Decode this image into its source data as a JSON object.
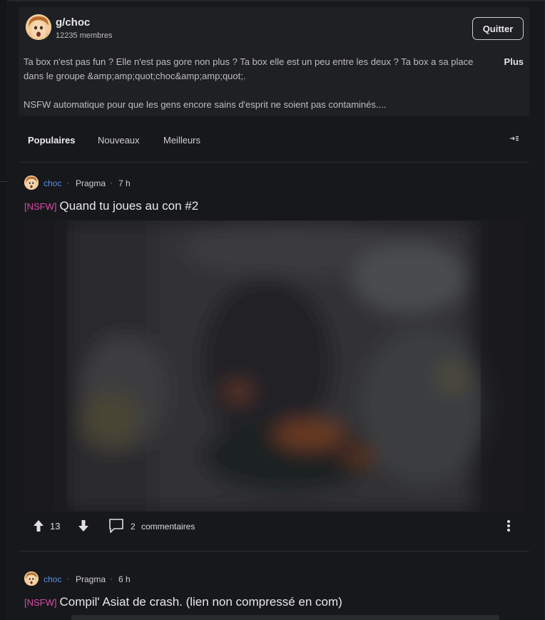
{
  "group": {
    "name": "g/choc",
    "members": "12235 membres",
    "quit_label": "Quitter",
    "description_line1": "Ta box n'est pas fun ? Elle n'est pas gore non plus ? Ta box elle est un peu entre les deux ? Ta box a sa place",
    "description_line2": "dans le groupe &amp;amp;quot;choc&amp;amp;quot;.",
    "description_line3": "NSFW automatique pour que les gens encore sains d'esprit ne soient pas contaminés....",
    "more_label": "Plus"
  },
  "sort_tabs": [
    {
      "label": "Populaires",
      "active": true
    },
    {
      "label": "Nouveaux",
      "active": false
    },
    {
      "label": "Meilleurs",
      "active": false
    }
  ],
  "posts": [
    {
      "group": "choc",
      "separator": "·",
      "user": "Pragma",
      "time": "7 h",
      "tag": "[NSFW]",
      "title": "Quand tu joues au con #2",
      "upvotes": "13",
      "comments_count": "2",
      "comments_label": "commentaires"
    },
    {
      "group": "choc",
      "separator": "·",
      "user": "Pragma",
      "time": "6 h",
      "tag": "[NSFW]",
      "title": "Compil' Asiat de crash. (lien non compressé en com)"
    }
  ],
  "icons": {
    "upvote": "arrow-up-icon",
    "downvote": "arrow-down-icon",
    "comment": "comment-bubble-icon",
    "more": "vertical-dots-icon",
    "layout": "arrow-to-lines-icon"
  },
  "colors": {
    "background": "#17181c",
    "card": "#1f2024",
    "group_link": "#5b8fe0",
    "nsfw_tag": "#d64ea5"
  }
}
